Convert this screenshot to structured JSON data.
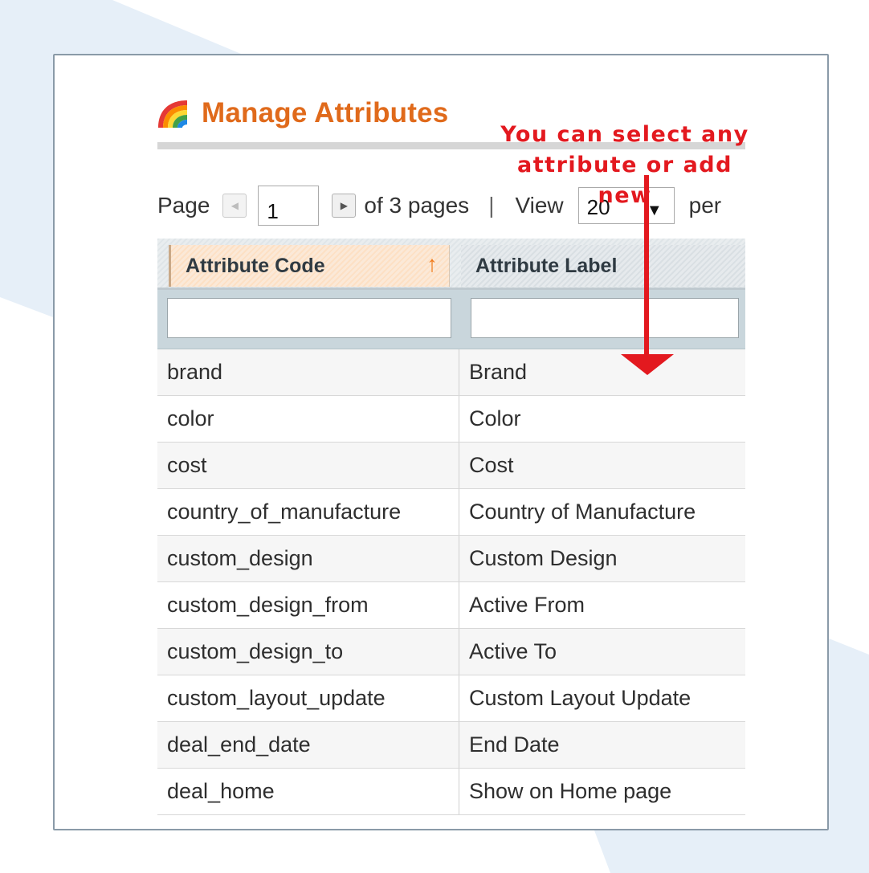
{
  "header": {
    "title": "Manage Attributes",
    "title_color": "#e06a1b",
    "icon": "rainbow-icon"
  },
  "annotation": {
    "line1": "You can select any",
    "line2": "attribute or add new",
    "color": "#e3191f"
  },
  "pager": {
    "page_label": "Page",
    "current_page": "1",
    "of_pages": "of 3 pages",
    "separator": "|",
    "view_label": "View",
    "per_page": "20",
    "per_label": "per",
    "prev_icon": "prev-page-icon",
    "next_icon": "next-page-icon"
  },
  "grid": {
    "columns": [
      {
        "label": "Attribute Code",
        "sorted": "ascending"
      },
      {
        "label": "Attribute Label"
      }
    ],
    "filters": {
      "code": "",
      "label": ""
    },
    "rows": [
      {
        "code": "brand",
        "label": "Brand"
      },
      {
        "code": "color",
        "label": "Color"
      },
      {
        "code": "cost",
        "label": "Cost"
      },
      {
        "code": "country_of_manufacture",
        "label": "Country of Manufacture"
      },
      {
        "code": "custom_design",
        "label": "Custom Design"
      },
      {
        "code": "custom_design_from",
        "label": "Active From"
      },
      {
        "code": "custom_design_to",
        "label": "Active To"
      },
      {
        "code": "custom_layout_update",
        "label": "Custom Layout Update"
      },
      {
        "code": "deal_end_date",
        "label": "End Date"
      },
      {
        "code": "deal_home",
        "label": "Show on Home page"
      }
    ]
  }
}
